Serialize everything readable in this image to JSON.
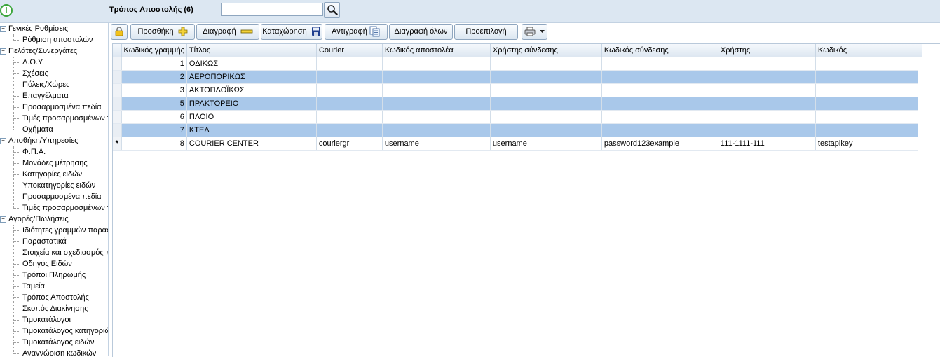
{
  "header": {
    "title": "Τρόπος Αποστολής (6)",
    "search_value": ""
  },
  "sidebar": {
    "groups": [
      {
        "label": "Γενικές Ρυθμίσεις",
        "toggle": "−",
        "items": [
          "Ρύθμιση αποστολών"
        ]
      },
      {
        "label": "Πελάτες/Συνεργάτες",
        "toggle": "−",
        "items": [
          "Δ.Ο.Υ.",
          "Σχέσεις",
          "Πόλεις/Χώρες",
          "Επαγγέλματα",
          "Προσαρμοσμένα πεδία",
          "Τιμές προσαρμοσμένων τ",
          "Οχήματα"
        ]
      },
      {
        "label": "Αποθήκη/Υπηρεσίες",
        "toggle": "−",
        "items": [
          "Φ.Π.Α.",
          "Μονάδες μέτρησης",
          "Κατηγορίες ειδών",
          "Υποκατηγορίες ειδών",
          "Προσαρμοσμένα πεδία",
          "Τιμές προσαρμοσμένων τ"
        ]
      },
      {
        "label": "Αγορές/Πωλήσεις",
        "toggle": "−",
        "items": [
          "Ιδιότητες γραμμών παρασ",
          "Παραστατικά",
          "Στοιχεία και σχεδιασμός π",
          "Οδηγός Ειδών",
          "Τρόποι Πληρωμής",
          "Ταμεία",
          "Τρόπος Αποστολής",
          "Σκοπός Διακίνησης",
          "Τιμοκατάλογοι",
          "Τιμοκατάλογος κατηγοριώ",
          "Τιμοκατάλογος ειδών",
          "Αναγνώριση κωδικών"
        ]
      }
    ]
  },
  "toolbar": {
    "add_label": "Προσθήκη",
    "delete_label": "Διαγραφή",
    "save_label": "Καταχώρηση",
    "copy_label": "Αντιγραφή",
    "delete_all_label": "Διαγραφή όλων",
    "default_label": "Προεπιλογή"
  },
  "grid": {
    "columns": [
      "Κωδικός γραμμής",
      "Τίτλος",
      "Courier",
      "Κωδικός αποστολέα",
      "Χρήστης σύνδεσης",
      "Κωδικός σύνδεσης",
      "Χρήστης",
      "Κωδικός"
    ],
    "rows": [
      {
        "marker": "",
        "code": "1",
        "title": "ΟΔΙΚΩΣ",
        "courier": "",
        "sender_code": "",
        "login_user": "",
        "login_code": "",
        "user": "",
        "key": ""
      },
      {
        "marker": "",
        "code": "2",
        "title": "ΑΕΡΟΠΟΡΙΚΩΣ",
        "courier": "",
        "sender_code": "",
        "login_user": "",
        "login_code": "",
        "user": "",
        "key": ""
      },
      {
        "marker": "",
        "code": "3",
        "title": "ΑΚΤΟΠΛΟΪΚΩΣ",
        "courier": "",
        "sender_code": "",
        "login_user": "",
        "login_code": "",
        "user": "",
        "key": ""
      },
      {
        "marker": "",
        "code": "5",
        "title": "ΠΡΑΚΤΟΡΕΙΟ",
        "courier": "",
        "sender_code": "",
        "login_user": "",
        "login_code": "",
        "user": "",
        "key": ""
      },
      {
        "marker": "",
        "code": "6",
        "title": "ΠΛΟΙΟ",
        "courier": "",
        "sender_code": "",
        "login_user": "",
        "login_code": "",
        "user": "",
        "key": ""
      },
      {
        "marker": "",
        "code": "7",
        "title": "ΚΤΕΛ",
        "courier": "",
        "sender_code": "",
        "login_user": "",
        "login_code": "",
        "user": "",
        "key": ""
      },
      {
        "marker": "*",
        "code": "8",
        "title": "COURIER CENTER",
        "courier": "couriergr",
        "sender_code": "username",
        "login_user": "username",
        "login_code": "password123example",
        "user": "111-1111-111",
        "key": "testapikey"
      }
    ]
  },
  "colors": {
    "alt_row": "#a9c8ea",
    "topbar": "#dce7f2",
    "info_icon": "#3aa53a",
    "add_icon": "#e8c11a",
    "save_icon": "#1f3f8f"
  },
  "icons": [
    "info-icon",
    "search-icon",
    "lock-icon",
    "plus-icon",
    "minus-icon",
    "floppy-disk-icon",
    "copy-icon",
    "printer-icon",
    "chevron-down-icon"
  ]
}
